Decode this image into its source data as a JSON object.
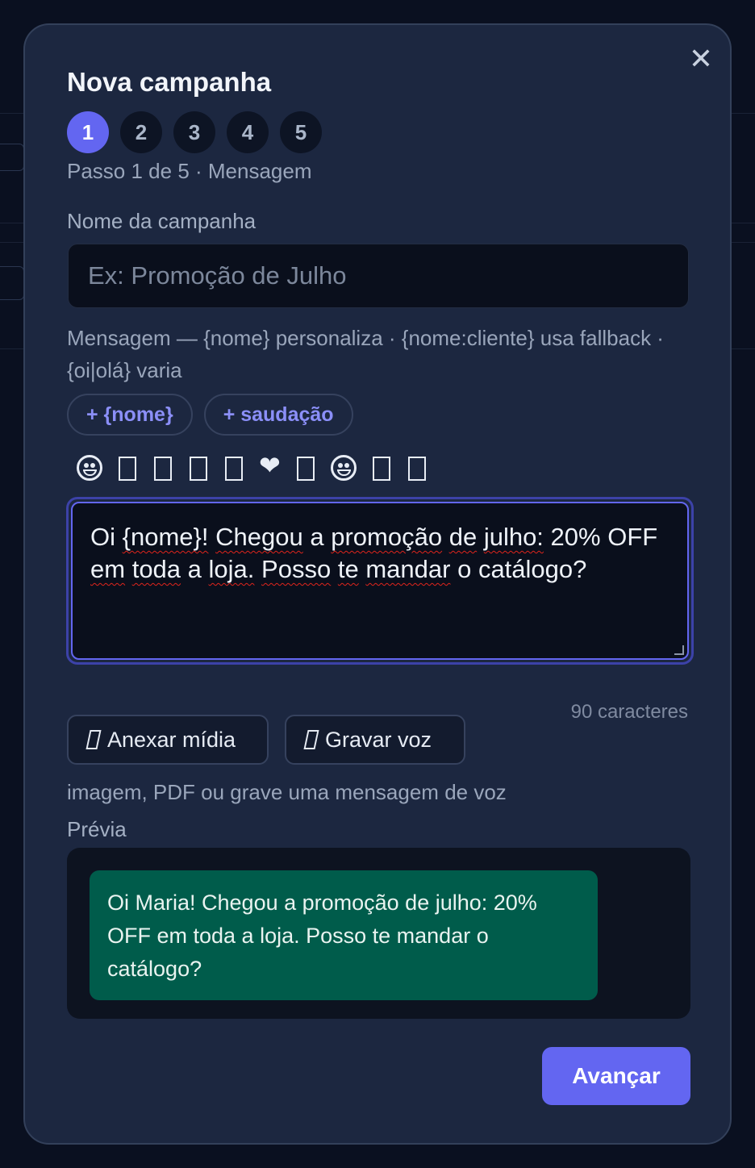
{
  "modal": {
    "title": "Nova campanha",
    "close_icon": "close-icon"
  },
  "steps": {
    "items": [
      "1",
      "2",
      "3",
      "4",
      "5"
    ],
    "current": 1,
    "caption": "Passo 1 de 5 · Mensagem"
  },
  "campaign_name": {
    "label": "Nome da campanha",
    "placeholder": "Ex: Promoção de Julho",
    "value": ""
  },
  "message": {
    "hint": "Mensagem — {nome} personaliza · {nome:cliente} usa fallback · {oi|olá} varia",
    "chips": [
      "+ {nome}",
      "+ saudação"
    ],
    "emojis": [
      "grinning-face",
      "box",
      "box",
      "box",
      "box",
      "red-heart",
      "box",
      "tears-of-joy-face",
      "box",
      "box"
    ],
    "heart": "❤",
    "text": "Oi {nome}! Chegou a promoção de julho: 20% OFF em toda a loja. Posso te mandar o catálogo?",
    "char_count": "90 caracteres"
  },
  "media": {
    "attach_label": "Anexar mídia",
    "record_label": "Gravar voz",
    "hint": "imagem, PDF ou grave uma mensagem de voz"
  },
  "preview": {
    "label": "Prévia",
    "text": "Oi Maria! Chegou a promoção de julho: 20% OFF em toda a loja. Posso te mandar o catálogo?"
  },
  "actions": {
    "next_label": "Avançar"
  },
  "colors": {
    "accent": "#6366f1",
    "modal_bg": "#1c2740",
    "bubble_bg": "#005c4b"
  }
}
